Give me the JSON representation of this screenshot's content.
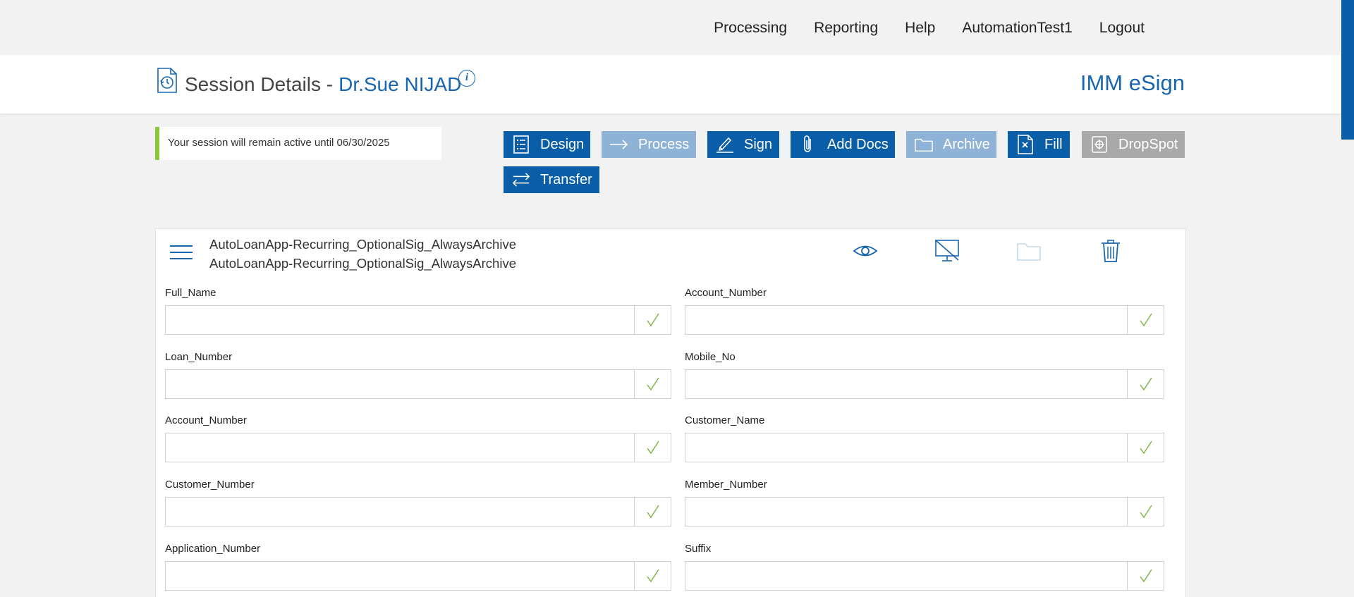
{
  "nav": [
    "Processing",
    "Reporting",
    "Help",
    "AutomationTest1",
    "Logout"
  ],
  "header": {
    "title": "Session Details -",
    "name": "Dr.Sue NIJAD",
    "info_glyph": "i",
    "brand": "IMM eSign"
  },
  "notice": "Your session will remain active until 06/30/2025",
  "toolbar": {
    "design": "Design",
    "process": "Process",
    "sign": "Sign",
    "add_docs": "Add Docs",
    "archive": "Archive",
    "fill": "Fill",
    "dropspot": "DropSpot",
    "transfer": "Transfer"
  },
  "document": {
    "line1": "AutoLoanApp-Recurring_OptionalSig_AlwaysArchive",
    "line2": "AutoLoanApp-Recurring_OptionalSig_AlwaysArchive"
  },
  "fields": {
    "left": [
      {
        "label": "Full_Name",
        "value": ""
      },
      {
        "label": "Loan_Number",
        "value": ""
      },
      {
        "label": "Account_Number",
        "value": ""
      },
      {
        "label": "Customer_Number",
        "value": ""
      },
      {
        "label": "Application_Number",
        "value": ""
      }
    ],
    "right": [
      {
        "label": "Account_Number",
        "value": ""
      },
      {
        "label": "Mobile_No",
        "value": ""
      },
      {
        "label": "Customer_Name",
        "value": ""
      },
      {
        "label": "Member_Number",
        "value": ""
      },
      {
        "label": "Suffix",
        "value": ""
      }
    ]
  },
  "colors": {
    "primary": "#0a5ea8",
    "primary_disabled": "#8fb3d6",
    "accent_green": "#8cc63f",
    "check_green": "#7cb342",
    "disabled_grey": "#a9a9a9"
  }
}
